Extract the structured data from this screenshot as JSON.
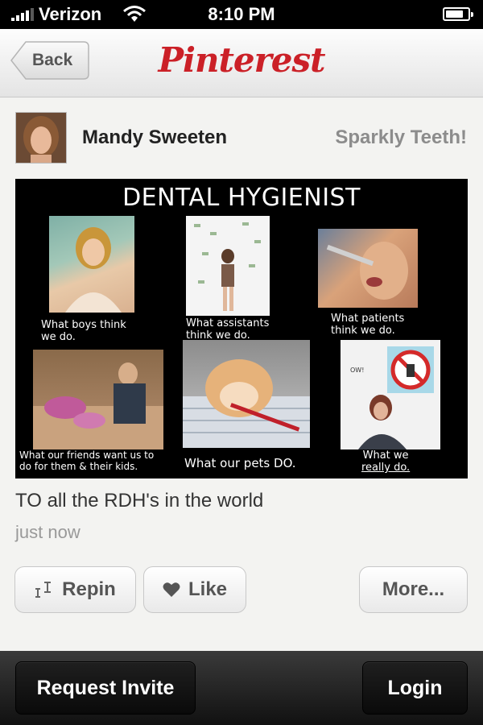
{
  "status_bar": {
    "carrier": "Verizon",
    "time": "8:10 PM",
    "icons": [
      "signal-bars-icon",
      "wifi-icon",
      "battery-icon"
    ]
  },
  "nav": {
    "back_label": "Back",
    "logo_text": "Pinterest",
    "logo_color": "#cb2027"
  },
  "pin": {
    "author": "Mandy Sweeten",
    "board": "Sparkly Teeth!",
    "image": {
      "title": "DENTAL HYGIENIST",
      "captions": {
        "boys": [
          "What boys think",
          "we do."
        ],
        "assistants": [
          "What assistants",
          "think we do."
        ],
        "patients": [
          "What patients",
          "think we do."
        ],
        "friends": [
          "What our friends want us to",
          "do for them & their kids."
        ],
        "pets": [
          "What our pets DO."
        ],
        "really": [
          "What we",
          "really do."
        ]
      },
      "small_text": "OW!"
    },
    "description": "TO all the RDH's in the world",
    "timestamp": "just now"
  },
  "actions": {
    "repin": "Repin",
    "like": "Like",
    "more": "More..."
  },
  "bottom_bar": {
    "request_invite": "Request Invite",
    "login": "Login"
  }
}
